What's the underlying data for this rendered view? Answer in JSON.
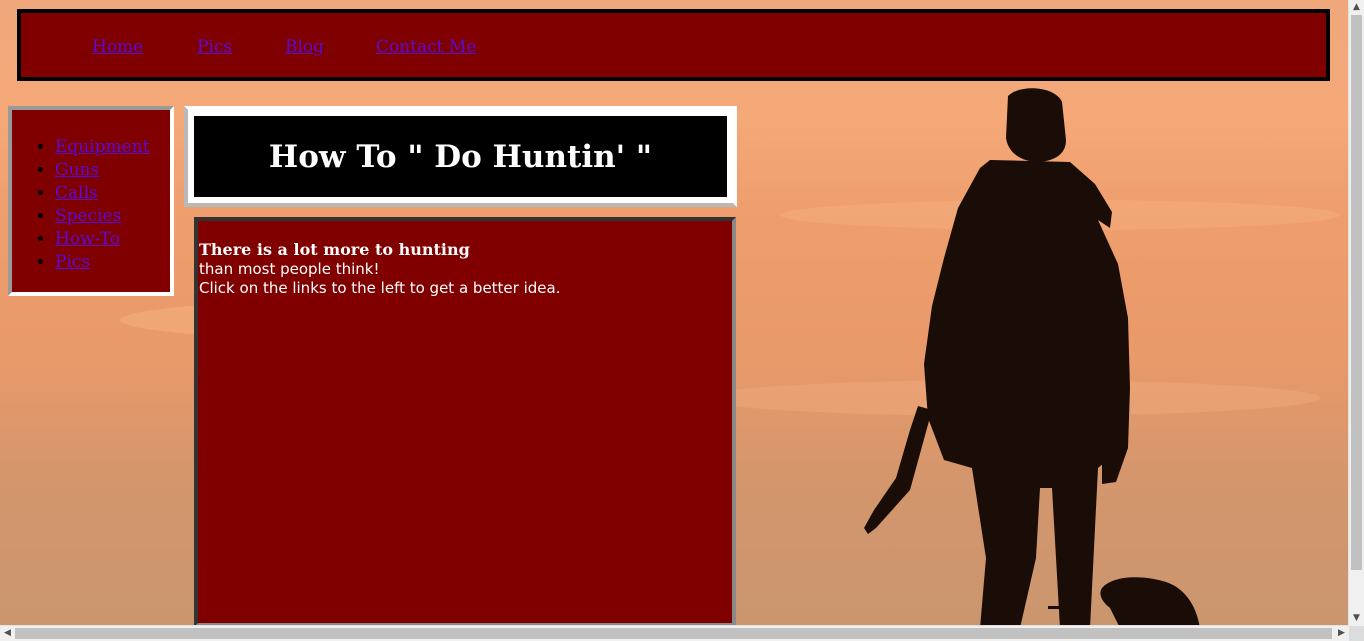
{
  "topnav": {
    "items": [
      {
        "label": "Home"
      },
      {
        "label": "Pics"
      },
      {
        "label": "Blog"
      },
      {
        "label": "Contact Me"
      }
    ]
  },
  "sidenav": {
    "items": [
      {
        "label": "Equipment"
      },
      {
        "label": "Guns"
      },
      {
        "label": "Calls"
      },
      {
        "label": "Species"
      },
      {
        "label": "How-To"
      },
      {
        "label": "Pics"
      }
    ]
  },
  "header": {
    "title": "How To \" Do Huntin' \""
  },
  "content": {
    "line1": "There is a lot more to hunting",
    "line2": "than most people think!",
    "line3": "Click on the links to the left to get a better idea."
  },
  "colors": {
    "panel": "#800000",
    "link": "#5a0ad6",
    "header_bg": "#000000"
  },
  "icons": {
    "scroll_up": "up-arrow-icon",
    "scroll_down": "down-arrow-icon",
    "scroll_left": "left-arrow-icon",
    "scroll_right": "right-arrow-icon"
  }
}
